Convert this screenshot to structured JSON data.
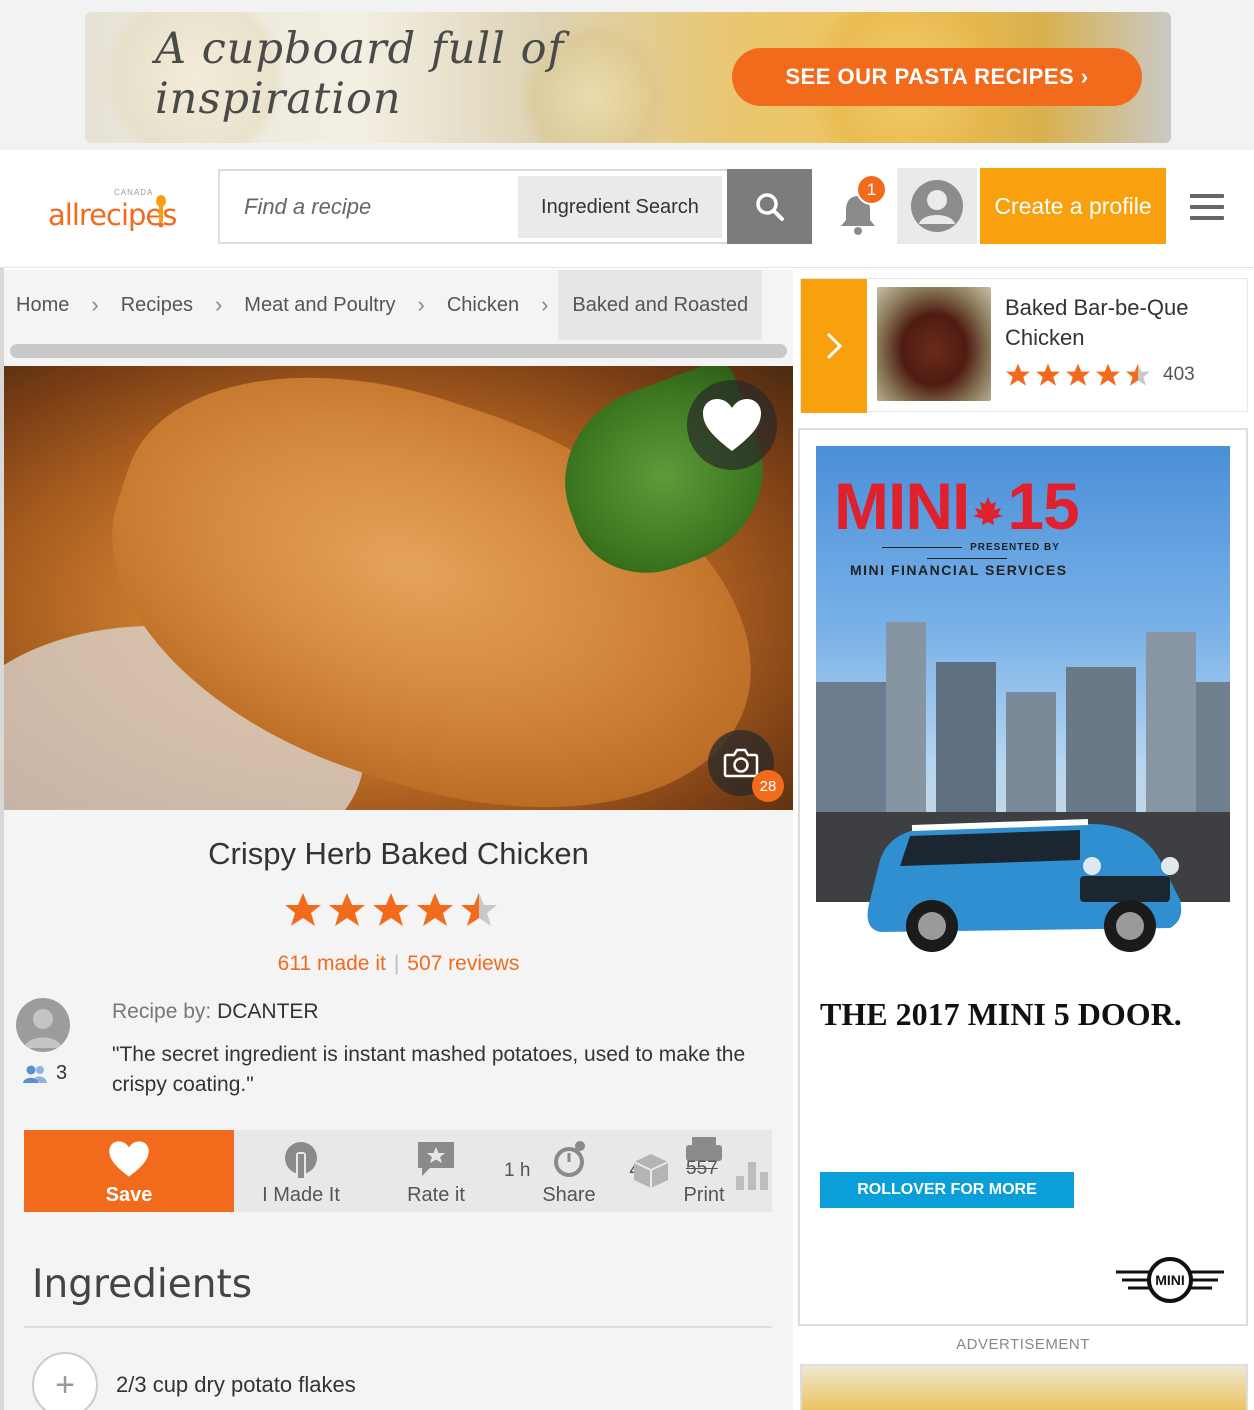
{
  "promo_banner": {
    "tagline": "A cupboard full of inspiration",
    "cta_label": "SEE OUR PASTA RECIPES ›"
  },
  "header": {
    "logo_country": "CANADA",
    "logo_text": "allrecipes",
    "search_placeholder": "Find a recipe",
    "ingredient_search_label": "Ingredient Search",
    "notification_count": "1",
    "create_profile_label": "Create a profile"
  },
  "breadcrumb": [
    "Home",
    "Recipes",
    "Meat and Poultry",
    "Chicken",
    "Baked and Roasted"
  ],
  "recipe": {
    "photo_count": "28",
    "title": "Crispy Herb Baked Chicken",
    "rating": 4.5,
    "made_it": "611 made it",
    "reviews": "507 reviews",
    "recipe_by_label": "Recipe by:",
    "author": "DCANTER",
    "followers": "3",
    "quote": "\"The secret ingredient is instant mashed potatoes, used to make the crispy coating.\""
  },
  "actions": {
    "save": "Save",
    "made_it": "I Made It",
    "rate_it": "Rate it",
    "share": "Share",
    "print": "Print",
    "time": "1 h",
    "servings": "4",
    "calories": "557"
  },
  "ingredients": {
    "heading": "Ingredients",
    "items": [
      "2/3 cup dry potato flakes"
    ]
  },
  "related": {
    "title": "Baked Bar-be-Que Chicken",
    "rating": 4.5,
    "count": "403"
  },
  "ad": {
    "brand": "MINI",
    "brand_number": "15",
    "presented_by": "PRESENTED BY",
    "financial": "MINI FINANCIAL SERVICES",
    "headline": "THE 2017 MINI 5 DOOR.",
    "rollover": "ROLLOVER FOR MORE",
    "logo_text": "MINI",
    "label": "ADVERTISEMENT"
  },
  "colors": {
    "accent_orange": "#f26b1d",
    "profile_yellow": "#f8a00e",
    "ad_red": "#e0202d",
    "ad_blue": "#0b9fd9"
  }
}
